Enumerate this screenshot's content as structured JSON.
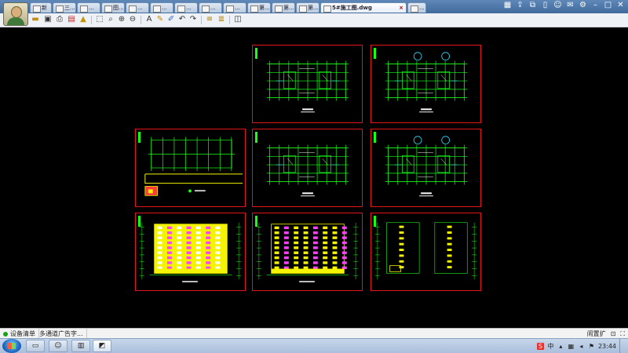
{
  "tabs": [
    {
      "label": "新",
      "active": false
    },
    {
      "label": "三...",
      "active": false
    },
    {
      "label": "...",
      "active": false
    },
    {
      "label": "图...",
      "active": false
    },
    {
      "label": "...",
      "active": false
    },
    {
      "label": "...",
      "active": false
    },
    {
      "label": "...",
      "active": false
    },
    {
      "label": "...",
      "active": false
    },
    {
      "label": "...",
      "active": false
    },
    {
      "label": "第...",
      "active": false
    },
    {
      "label": "第...",
      "active": false
    },
    {
      "label": "第...",
      "active": false
    },
    {
      "label": "5#施工图.dwg",
      "active": true
    },
    {
      "label": "...",
      "active": false
    }
  ],
  "status": {
    "item1": "设备清单",
    "item2": "多通道广告字...",
    "zoom_label": "闹置扩"
  },
  "taskbar": {
    "time": "23:44",
    "tray_badge": "S"
  },
  "colors": {
    "sheet_border": "#e21616",
    "drawing_green": "#18ff18",
    "drawing_yellow": "#f4f400",
    "drawing_magenta": "#ff40ff",
    "drawing_cyan": "#33e0ff"
  }
}
